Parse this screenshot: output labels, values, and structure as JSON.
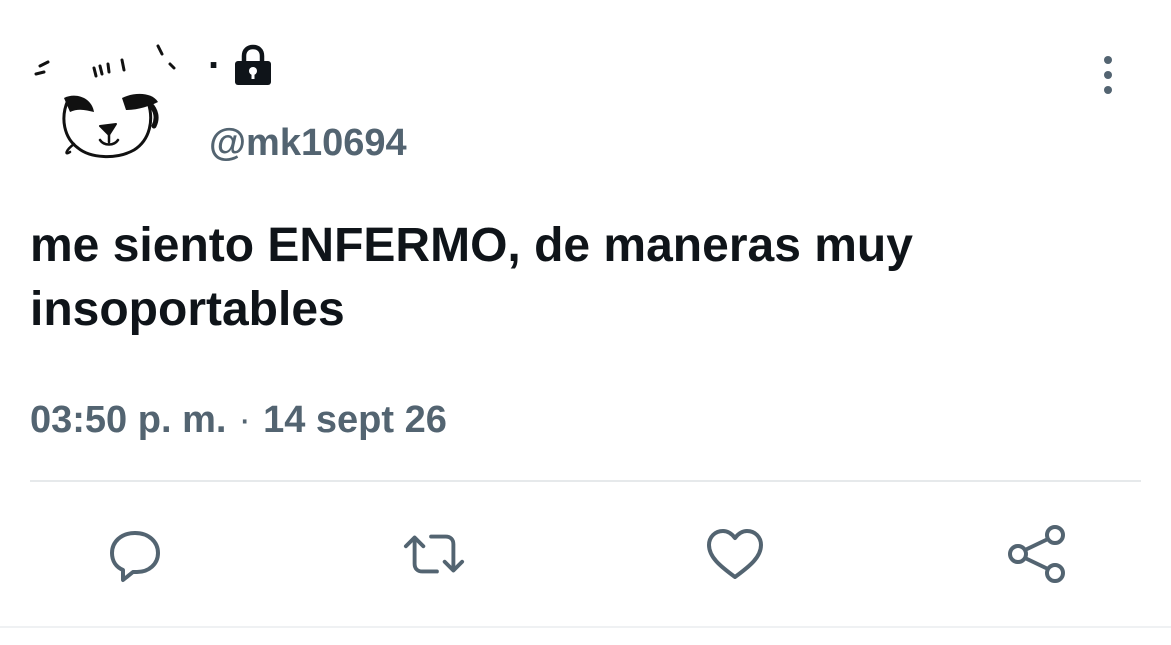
{
  "user": {
    "display_name": ".",
    "handle": "@mk10694",
    "protected_icon": "lock-icon",
    "avatar": "cat-face-sketch"
  },
  "tweet": {
    "text": "me siento ENFERMO, de maneras muy insoportables",
    "time": "03:50 p. m.",
    "separator": "·",
    "date": "14 sept 26"
  },
  "actions": {
    "reply_icon": "reply-icon",
    "retweet_icon": "retweet-icon",
    "like_icon": "heart-icon",
    "share_icon": "share-icon",
    "more_icon": "more-vertical-icon"
  },
  "colors": {
    "text": "#0f1419",
    "secondary": "#536471",
    "divider": "#e6e9eb"
  }
}
